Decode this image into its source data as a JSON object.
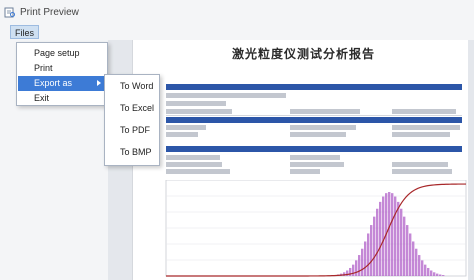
{
  "window": {
    "title": "Print Preview"
  },
  "menubar": {
    "files_label": "Files"
  },
  "files_menu": {
    "items": [
      {
        "label": "Page setup"
      },
      {
        "label": "Print"
      },
      {
        "label": "Export as"
      },
      {
        "label": "Exit"
      }
    ],
    "selected": "Export as"
  },
  "export_submenu": {
    "items": [
      {
        "label": "To Word"
      },
      {
        "label": "To Excel"
      },
      {
        "label": "To PDF"
      },
      {
        "label": "To BMP"
      }
    ]
  },
  "report": {
    "title": "激光粒度仪测试分析报告",
    "instrument": "",
    "version": "",
    "print_time": "",
    "sections": {
      "sample_info": "",
      "testing_info": "",
      "analysis_result": ""
    },
    "dispersed_phase": "",
    "chart": {
      "left_axis_label": "",
      "right_axis_label": ""
    }
  },
  "colors": {
    "menu_highlight": "#3d7bd6",
    "section_bar": "#2c56a8",
    "histogram": "#b060c8",
    "cumulative_line": "#a8282a"
  }
}
